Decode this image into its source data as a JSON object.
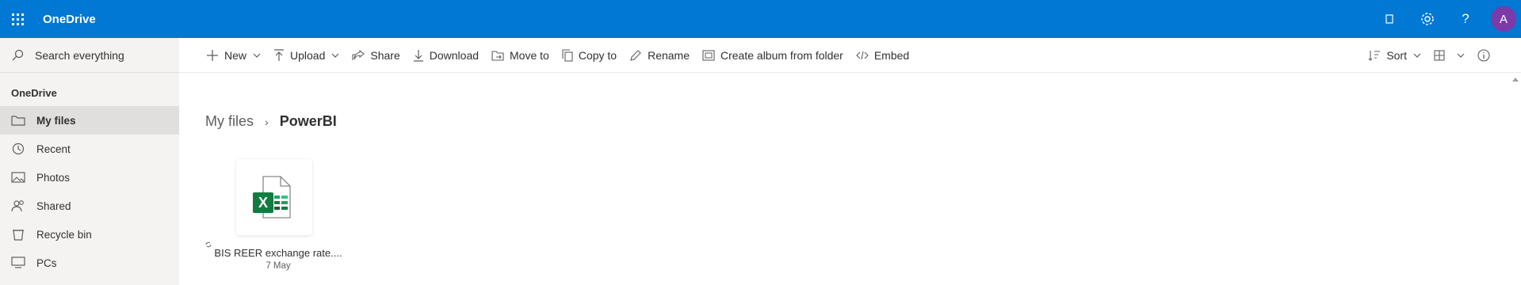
{
  "app": {
    "name": "OneDrive",
    "avatar_initial": "A"
  },
  "search": {
    "placeholder": "Search everything"
  },
  "sidebar": {
    "heading": "OneDrive",
    "items": [
      {
        "label": "My files",
        "icon": "folder-icon",
        "active": true
      },
      {
        "label": "Recent",
        "icon": "history-icon"
      },
      {
        "label": "Photos",
        "icon": "photo-icon"
      },
      {
        "label": "Shared",
        "icon": "people-icon"
      },
      {
        "label": "Recycle bin",
        "icon": "recycle-bin-icon"
      },
      {
        "label": "PCs",
        "icon": "monitor-icon"
      }
    ]
  },
  "commands": {
    "new": "New",
    "upload": "Upload",
    "share": "Share",
    "download": "Download",
    "move_to": "Move to",
    "copy_to": "Copy to",
    "rename": "Rename",
    "create_album": "Create album from folder",
    "embed": "Embed",
    "sort": "Sort"
  },
  "breadcrumb": {
    "parent": "My files",
    "current": "PowerBI"
  },
  "files": [
    {
      "name": "BIS REER exchange rate....",
      "date": "7 May",
      "type": "excel-file-icon"
    }
  ],
  "colors": {
    "suite_bar": "#0078d4",
    "excel_green": "#107c41",
    "avatar": "#7b3aa8"
  }
}
